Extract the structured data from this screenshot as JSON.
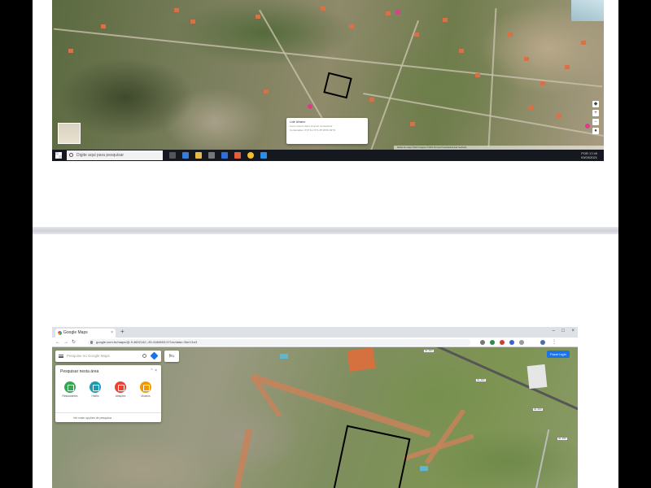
{
  "document": {
    "top_screenshot": {
      "map_info_card": {
        "title": "Lote Urbano",
        "line1": "Lorem ipsum dolor sit amet consectetur",
        "line2": "Cordenadas: 9°27'41.74\"S 35°25'00.09\"W"
      },
      "map_footer": "Dados do mapa ©2021  Imagens ©2021  Termos  Privacidade  Enviar feedback",
      "taskbar": {
        "search_placeholder": "Digite aqui para pesquisar",
        "tray_time": "17:49",
        "tray_date": "03/03/2021",
        "tray_lang": "POR"
      }
    },
    "bottom_screenshot": {
      "browser": {
        "tab_title": "Google Maps",
        "address": "google.com.br/maps/@-9.4602142,-35.4166693,571m/data=!3m1!1e3"
      },
      "maps": {
        "search_placeholder": "Pesquise no Google Maps",
        "login_button": "Fazer login",
        "panel_title": "Pesquisar nesta área",
        "quick_actions": [
          {
            "label": "Restaurantes",
            "color": "#34a853"
          },
          {
            "label": "Hotéis",
            "color": "#1a9bb0"
          },
          {
            "label": "Atrações",
            "color": "#ea4335"
          },
          {
            "label": "Museus",
            "color": "#f29900"
          }
        ],
        "panel_footer": "Ver mais opções de pesquisa",
        "road_shields": [
          "AL-101",
          "AL-101",
          "AL-101",
          "AL-101"
        ]
      }
    }
  }
}
